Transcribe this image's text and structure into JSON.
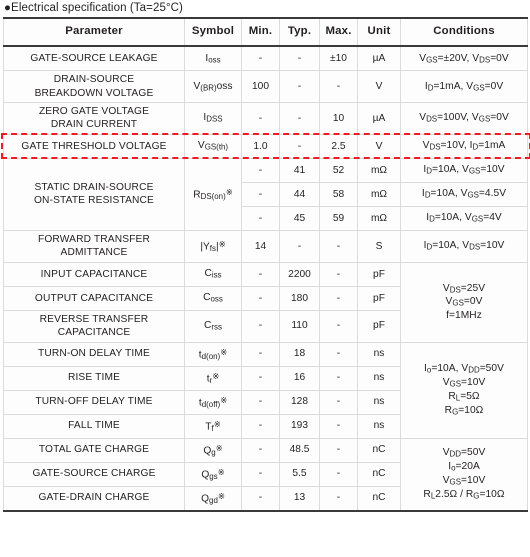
{
  "caption": "●Electrical specification (Ta=25°C)",
  "accent_highlight_color": "#ee1b24",
  "columns": [
    "Parameter",
    "Symbol",
    "Min.",
    "Typ.",
    "Max.",
    "Unit",
    "Conditions"
  ],
  "rows": [
    {
      "parameter": "GATE-SOURCE LEAKAGE",
      "symbol_html": "I<sub>oss</sub>",
      "min": "-",
      "typ": "-",
      "max": "±10",
      "unit": "µA",
      "cond_html": "V<sub>GS</sub>=±20V, V<sub>DS</sub>=0V"
    },
    {
      "parameter_lines": [
        "DRAIN-SOURCE",
        "BREAKDOWN VOLTAGE"
      ],
      "symbol_html": "V<sub>(BR)</sub>oss",
      "min": "100",
      "typ": "-",
      "max": "-",
      "unit": "V",
      "cond_html": "I<sub>D</sub>=1mA, V<sub>GS</sub>=0V"
    },
    {
      "parameter_lines": [
        "ZERO GATE VOLTAGE",
        "DRAIN CURRENT"
      ],
      "symbol_html": "I<sub>DSS</sub>",
      "min": "-",
      "typ": "-",
      "max": "10",
      "unit": "µA",
      "cond_html": "V<sub>DS</sub>=100V, V<sub>GS</sub>=0V"
    },
    {
      "parameter": "GATE THRESHOLD VOLTAGE",
      "symbol_html": "V<sub>GS(th)</sub>",
      "min": "1.0",
      "typ": "-",
      "max": "2.5",
      "unit": "V",
      "cond_html": "V<sub>DS</sub>=10V, I<sub>D</sub>=1mA",
      "highlighted": true
    },
    {
      "parameter_lines": [
        "STATIC DRAIN-SOURCE",
        "ON-STATE RESISTANCE"
      ],
      "symbol_html": "R<sub>DS(on)</sub><sup class=\"star\">※</sup>",
      "subrows": [
        {
          "min": "-",
          "typ": "41",
          "max": "52",
          "unit": "mΩ",
          "cond_html": "I<sub>D</sub>=10A, V<sub>GS</sub>=10V"
        },
        {
          "min": "-",
          "typ": "44",
          "max": "58",
          "unit": "mΩ",
          "cond_html": "I<sub>D</sub>=10A, V<sub>GS</sub>=4.5V"
        },
        {
          "min": "-",
          "typ": "45",
          "max": "59",
          "unit": "mΩ",
          "cond_html": "I<sub>D</sub>=10A, V<sub>GS</sub>=4V"
        }
      ]
    },
    {
      "parameter_lines": [
        "FORWARD TRANSFER",
        "ADMITTANCE"
      ],
      "symbol_html": "|Y<sub>fs</sub>|<sup class=\"star\">※</sup>",
      "min": "14",
      "typ": "-",
      "max": "-",
      "unit": "S",
      "cond_html": "I<sub>D</sub>=10A, V<sub>DS</sub>=10V"
    },
    {
      "parameter": "INPUT CAPACITANCE",
      "symbol_html": "C<sub>iss</sub>",
      "min": "-",
      "typ": "2200",
      "max": "-",
      "unit": "pF",
      "group_cond_html": "V<sub>DS</sub>=25V<br>V<sub>GS</sub>=0V<br>f=1MHz",
      "group_cond_rowspan": 3
    },
    {
      "parameter": "OUTPUT CAPACITANCE",
      "symbol_html": "C<sub>oss</sub>",
      "min": "-",
      "typ": "180",
      "max": "-",
      "unit": "pF"
    },
    {
      "parameter_lines": [
        "REVERSE TRANSFER",
        "CAPACITANCE"
      ],
      "symbol_html": "C<sub>rss</sub>",
      "min": "-",
      "typ": "110",
      "max": "-",
      "unit": "pF"
    },
    {
      "parameter": "TURN-ON DELAY TIME",
      "symbol_html": "t<sub>d(on)</sub><sup class=\"star\">※</sup>",
      "min": "-",
      "typ": "18",
      "max": "-",
      "unit": "ns",
      "group_cond_html": "I<sub>o</sub>=10A, V<sub>DD</sub>=50V<br>V<sub>GS</sub>=10V<br>R<sub>L</sub>=5Ω<br>R<sub>G</sub>=10Ω",
      "group_cond_rowspan": 4
    },
    {
      "parameter": "RISE TIME",
      "symbol_html": "t<sub>r</sub><sup class=\"star\">※</sup>",
      "min": "-",
      "typ": "16",
      "max": "-",
      "unit": "ns"
    },
    {
      "parameter": "TURN-OFF DELAY TIME",
      "symbol_html": "t<sub>d(off)</sub><sup class=\"star\">※</sup>",
      "min": "-",
      "typ": "128",
      "max": "-",
      "unit": "ns"
    },
    {
      "parameter": "FALL TIME",
      "symbol_html": "T<sub>f</sub><sup class=\"star\">※</sup>",
      "min": "-",
      "typ": "193",
      "max": "-",
      "unit": "ns"
    },
    {
      "parameter": "TOTAL GATE CHARGE",
      "symbol_html": "Q<sub>g</sub><sup class=\"star\">※</sup>",
      "min": "-",
      "typ": "48.5",
      "max": "-",
      "unit": "nC",
      "group_cond_html": "V<sub>DD</sub>=50V<br>I<sub>o</sub>=20A<br>V<sub>GS</sub>=10V<br>R<sub>L</sub>2.5Ω / R<sub>G</sub>=10Ω",
      "group_cond_rowspan": 3
    },
    {
      "parameter": "GATE-SOURCE CHARGE",
      "symbol_html": "Q<sub>gs</sub><sup class=\"star\">※</sup>",
      "min": "-",
      "typ": "5.5",
      "max": "-",
      "unit": "nC"
    },
    {
      "parameter": "GATE-DRAIN CHARGE",
      "symbol_html": "Q<sub>gd</sub><sup class=\"star\">※</sup>",
      "min": "-",
      "typ": "13",
      "max": "-",
      "unit": "nC"
    }
  ]
}
